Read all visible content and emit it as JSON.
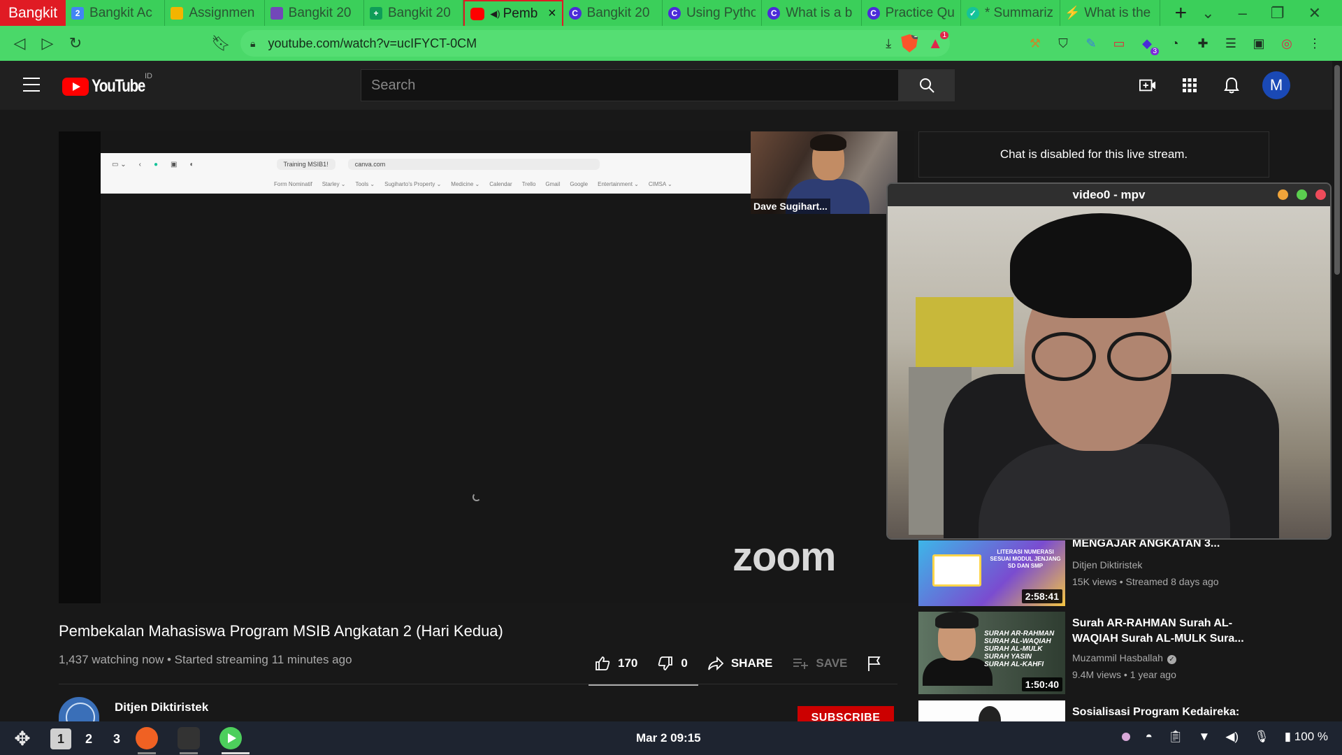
{
  "browser": {
    "profile_label": "Bangkit",
    "tabs": [
      {
        "label": "Bangkit Ac",
        "favicon": "docs-icon",
        "favicon_glyph": "2"
      },
      {
        "label": "Assignmen",
        "favicon": "classroom-icon",
        "favicon_glyph": ""
      },
      {
        "label": "Bangkit 20",
        "favicon": "forms-icon",
        "favicon_glyph": ""
      },
      {
        "label": "Bangkit 20",
        "favicon": "sheets-icon",
        "favicon_glyph": "+"
      },
      {
        "label": "Pemb",
        "favicon": "youtube-icon",
        "favicon_glyph": "",
        "active": true
      },
      {
        "label": "Bangkit 20",
        "favicon": "c-icon",
        "favicon_glyph": "C"
      },
      {
        "label": "Using Pytho",
        "favicon": "c-icon",
        "favicon_glyph": "C"
      },
      {
        "label": "What is a b",
        "favicon": "c-icon",
        "favicon_glyph": "C"
      },
      {
        "label": "Practice Qu",
        "favicon": "c-icon",
        "favicon_glyph": "C"
      },
      {
        "label": "* Summariz",
        "favicon": "grammarly-icon",
        "favicon_glyph": "✓"
      },
      {
        "label": "What is the",
        "favicon": "bolt-icon",
        "favicon_glyph": "⚡"
      }
    ],
    "url": "youtube.com/watch?v=ucIFYCT-0CM",
    "shield_count": "14",
    "rewards_count": "1",
    "ext_badge": "3"
  },
  "youtube": {
    "logo_text": "YouTube",
    "country_code": "ID",
    "search_placeholder": "Search",
    "avatar_letter": "M",
    "video": {
      "title": "Pembekalan Mahasiswa Program MSIB Angkatan 2 (Hari Kedua)",
      "meta": "1,437 watching now • Started streaming 11 minutes ago",
      "likes": "170",
      "dislikes": "0",
      "share_label": "SHARE",
      "save_label": "SAVE",
      "channel": "Ditjen Diktiristek",
      "subscribe_label": "SUBSCRIBE"
    },
    "player_content": {
      "shared_tab_1": "Training MSIB1!",
      "shared_tab_2": "canva.com",
      "bookmarks": [
        "Form Nominatif",
        "Starley ⌄",
        "Tools ⌄",
        "Sugiharto's Property ⌄",
        "Medicine ⌄",
        "Calendar",
        "Trello",
        "Gmail",
        "Google",
        "Entertainment ⌄",
        "CIMSA ⌄"
      ],
      "participant_name": "Dave Sugihart...",
      "zoom_logo": "zoom"
    },
    "chat_disabled": "Chat is disabled for this live stream.",
    "recommendations": [
      {
        "title": "MENGAJAR ANGKATAN 3...",
        "channel": "Ditjen Diktiristek",
        "verified": false,
        "stats": "15K views • Streamed 8 days ago",
        "duration": "2:58:41",
        "thumb_text": "LITERASI NUMERASI SESUAI MODUL JENJANG SD DAN SMP"
      },
      {
        "title": "Surah AR-RAHMAN Surah AL-WAQIAH Surah AL-MULK Sura...",
        "channel": "Muzammil Hasballah",
        "verified": true,
        "stats": "9.4M views • 1 year ago",
        "duration": "1:50:40",
        "thumb_lines": [
          "SURAH AR-RAHMAN",
          "SURAH AL-WAQIAH",
          "SURAH AL-MULK",
          "SURAH YASIN",
          "SURAH AL-KAHFI"
        ]
      },
      {
        "title": "Sosialisasi Program Kedaireka:",
        "channel": "",
        "verified": false,
        "stats": "",
        "duration": ""
      }
    ]
  },
  "mpv": {
    "title": "video0 - mpv",
    "dot_colors": [
      "#f0a43a",
      "#5bcf4f",
      "#ee4b5a"
    ]
  },
  "panel": {
    "workspaces": [
      "1",
      "2",
      "3"
    ],
    "active_workspace": "1",
    "clock": "Mar 2  09:15",
    "battery": "100 %"
  },
  "colors": {
    "browser_accent": "#3bcf5a",
    "youtube_red": "#ff0000",
    "subscribe_red": "#cc0000"
  }
}
